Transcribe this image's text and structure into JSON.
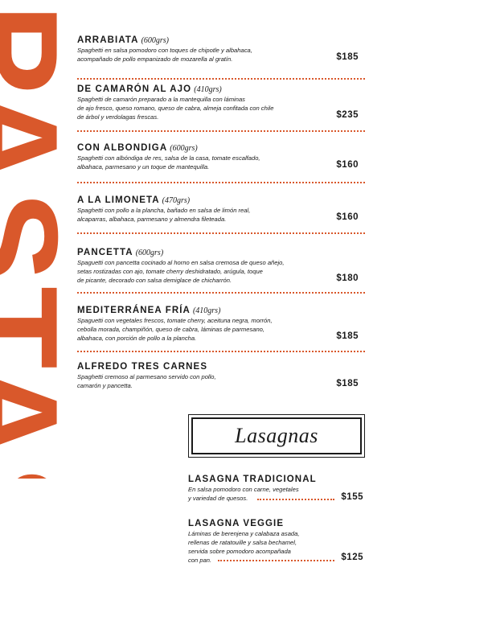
{
  "section_word": "PASTAS",
  "accent_color": "#d9582b",
  "pastas": [
    {
      "name": "ARRABIATA",
      "weight": "(600grs)",
      "desc": [
        "Spaghetti en salsa pomodoro con toques de chipotle y albahaca,",
        "acompañado de pollo empanizado de mozarella al gratín."
      ],
      "price": "$185"
    },
    {
      "name": "DE CAMARÓN AL AJO",
      "weight": "(410grs)",
      "desc": [
        "Spaghetti de camarón preparado a la mantequilla con láminas",
        "de ajo fresco, queso romano, queso de cabra, almeja confitada con chile",
        "de árbol y verdolagas frescas."
      ],
      "price": "$235"
    },
    {
      "name": "CON ALBONDIGA",
      "weight": "(600grs)",
      "desc": [
        "Spaghetti con albóndiga de res, salsa de la casa, tomate escalfado,",
        "albahaca, parmesano y un toque de mantequilla."
      ],
      "price": "$160"
    },
    {
      "name": "A LA LIMONETA",
      "weight": "(470grs)",
      "desc": [
        "Spaghetti con pollo a la plancha, bañado en salsa de limón real,",
        "alcaparras, albahaca, parmesano y almendra fileteada."
      ],
      "price": "$160"
    },
    {
      "name": "PANCETTA",
      "weight": "(600grs)",
      "desc": [
        "Spaguetti con pancetta cocinado al horno en salsa cremosa de queso añejo,",
        "setas rostizadas con ajo, tomate cherry deshidratado, arúgula, toque",
        "de picante, decorado con salsa demiglace de chicharrón."
      ],
      "price": "$180"
    },
    {
      "name": "MEDITERRÁNEA FRÍA",
      "weight": "(410grs)",
      "desc": [
        "Spaguetti con vegetales frescos, tomate cherry, aceituna negra, morrón,",
        "cebolla morada, champiñón, queso de cabra, láminas de parmesano,",
        "albahaca, con porción de pollo a la plancha."
      ],
      "price": "$185"
    },
    {
      "name": "ALFREDO TRES CARNES",
      "weight": "",
      "desc": [
        "Spaghetti cremoso al parmesano servido con pollo,",
        "camarón y pancetta."
      ],
      "price": "$185"
    }
  ],
  "lasagnas_heading": "Lasagnas",
  "lasagnas": [
    {
      "name": "LASAGNA TRADICIONAL",
      "desc": [
        "En salsa pomodoro con carne, vegetales",
        "y variedad de quesos."
      ],
      "price": "$155"
    },
    {
      "name": "LASAGNA VEGGIE",
      "desc": [
        "Láminas de berenjena y calabaza asada,",
        "rellenas de ratatouille y salsa bechamel,",
        "servida sobre pomodoro acompañada",
        "con pan."
      ],
      "price": "$125"
    }
  ]
}
